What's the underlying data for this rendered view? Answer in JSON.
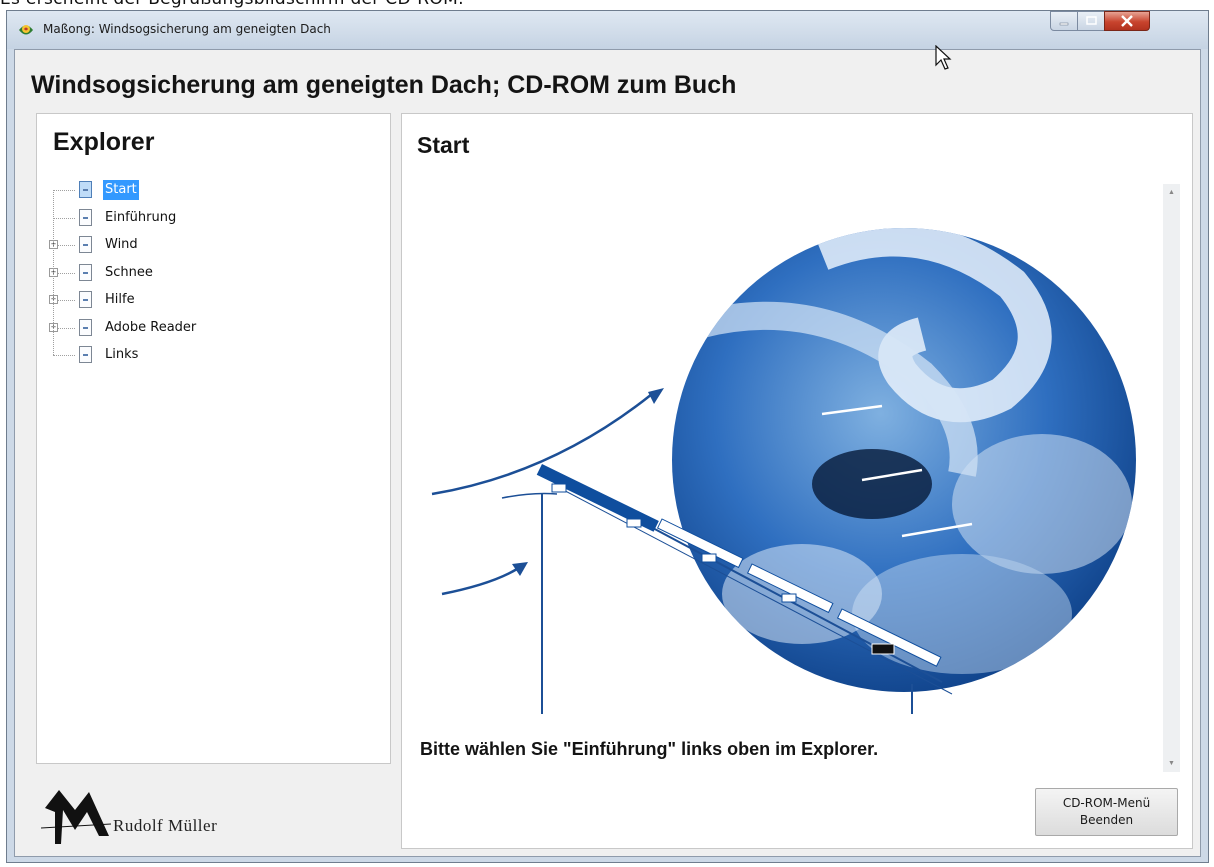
{
  "caption": "Es erscheint der Begrüßungsbildschirm der CD-ROM:",
  "window": {
    "title": "Maßong: Windsogsicherung am geneigten Dach",
    "controls": {
      "minimize": "minimize-icon",
      "maximize": "maximize-icon",
      "close": "close-icon"
    }
  },
  "app_heading": "Windsogsicherung am geneigten Dach; CD-ROM zum Buch",
  "explorer": {
    "title": "Explorer",
    "items": [
      {
        "label": "Start",
        "selected": true,
        "expandable": false
      },
      {
        "label": "Einführung",
        "selected": false,
        "expandable": false
      },
      {
        "label": "Wind",
        "selected": false,
        "expandable": true
      },
      {
        "label": "Schnee",
        "selected": false,
        "expandable": true
      },
      {
        "label": "Hilfe",
        "selected": false,
        "expandable": true
      },
      {
        "label": "Adobe Reader",
        "selected": false,
        "expandable": true
      },
      {
        "label": "Links",
        "selected": false,
        "expandable": false
      }
    ]
  },
  "logo_text": "Rudolf Müller",
  "content": {
    "title": "Start",
    "instruction": "Bitte wählen Sie \"Einführung\" links oben im Explorer."
  },
  "cdrom_button": {
    "line1": "CD-ROM-Menü",
    "line2": "Beenden"
  },
  "colors": {
    "accent": "#3399ff",
    "title_bar": "#cdd9e7",
    "illustration_blue": "#0f4e9e"
  }
}
